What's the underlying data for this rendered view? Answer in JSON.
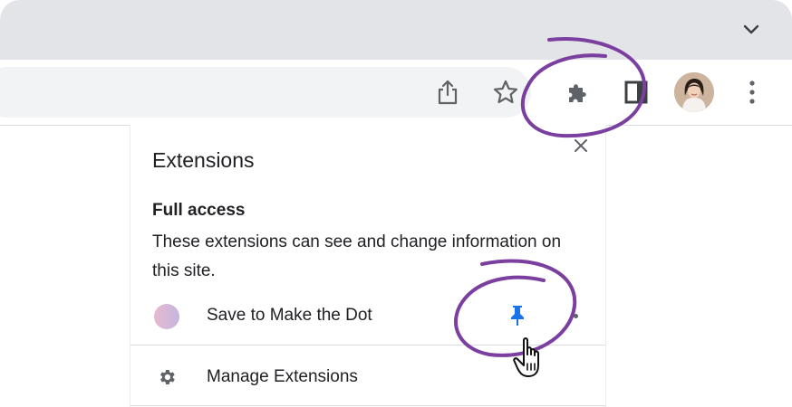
{
  "browser": {
    "icons": {
      "tab_menu": "chevron-down-icon",
      "share": "share-icon",
      "bookmark": "star-icon",
      "extensions": "puzzle-icon",
      "side_panel": "side-panel-icon",
      "profile": "avatar",
      "menu": "kebab-menu-icon"
    }
  },
  "popup": {
    "title": "Extensions",
    "full_access_heading": "Full access",
    "full_access_description": "These extensions can see and change information on this site.",
    "extensions": [
      {
        "name": "Save to Make the Dot",
        "pinned": true
      }
    ],
    "manage_label": "Manage Extensions"
  },
  "colors": {
    "annotation_purple": "#7b3fa0",
    "pin_blue": "#1a73e8",
    "tabstrip_gray": "#e3e4e8",
    "omnibox_gray": "#f1f3f4"
  }
}
